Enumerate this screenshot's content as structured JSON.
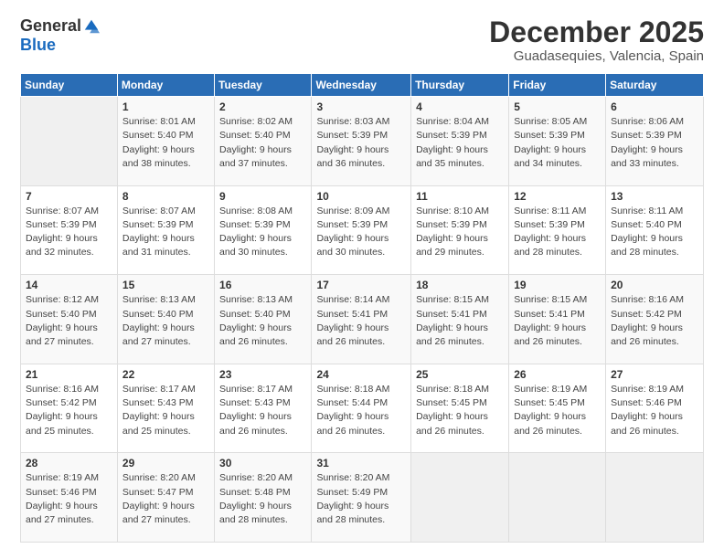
{
  "logo": {
    "general": "General",
    "blue": "Blue"
  },
  "title": "December 2025",
  "subtitle": "Guadasequies, Valencia, Spain",
  "header_days": [
    "Sunday",
    "Monday",
    "Tuesday",
    "Wednesday",
    "Thursday",
    "Friday",
    "Saturday"
  ],
  "weeks": [
    [
      {
        "day": "",
        "info": ""
      },
      {
        "day": "1",
        "info": "Sunrise: 8:01 AM\nSunset: 5:40 PM\nDaylight: 9 hours\nand 38 minutes."
      },
      {
        "day": "2",
        "info": "Sunrise: 8:02 AM\nSunset: 5:40 PM\nDaylight: 9 hours\nand 37 minutes."
      },
      {
        "day": "3",
        "info": "Sunrise: 8:03 AM\nSunset: 5:39 PM\nDaylight: 9 hours\nand 36 minutes."
      },
      {
        "day": "4",
        "info": "Sunrise: 8:04 AM\nSunset: 5:39 PM\nDaylight: 9 hours\nand 35 minutes."
      },
      {
        "day": "5",
        "info": "Sunrise: 8:05 AM\nSunset: 5:39 PM\nDaylight: 9 hours\nand 34 minutes."
      },
      {
        "day": "6",
        "info": "Sunrise: 8:06 AM\nSunset: 5:39 PM\nDaylight: 9 hours\nand 33 minutes."
      }
    ],
    [
      {
        "day": "7",
        "info": "Sunrise: 8:07 AM\nSunset: 5:39 PM\nDaylight: 9 hours\nand 32 minutes."
      },
      {
        "day": "8",
        "info": "Sunrise: 8:07 AM\nSunset: 5:39 PM\nDaylight: 9 hours\nand 31 minutes."
      },
      {
        "day": "9",
        "info": "Sunrise: 8:08 AM\nSunset: 5:39 PM\nDaylight: 9 hours\nand 30 minutes."
      },
      {
        "day": "10",
        "info": "Sunrise: 8:09 AM\nSunset: 5:39 PM\nDaylight: 9 hours\nand 30 minutes."
      },
      {
        "day": "11",
        "info": "Sunrise: 8:10 AM\nSunset: 5:39 PM\nDaylight: 9 hours\nand 29 minutes."
      },
      {
        "day": "12",
        "info": "Sunrise: 8:11 AM\nSunset: 5:39 PM\nDaylight: 9 hours\nand 28 minutes."
      },
      {
        "day": "13",
        "info": "Sunrise: 8:11 AM\nSunset: 5:40 PM\nDaylight: 9 hours\nand 28 minutes."
      }
    ],
    [
      {
        "day": "14",
        "info": "Sunrise: 8:12 AM\nSunset: 5:40 PM\nDaylight: 9 hours\nand 27 minutes."
      },
      {
        "day": "15",
        "info": "Sunrise: 8:13 AM\nSunset: 5:40 PM\nDaylight: 9 hours\nand 27 minutes."
      },
      {
        "day": "16",
        "info": "Sunrise: 8:13 AM\nSunset: 5:40 PM\nDaylight: 9 hours\nand 26 minutes."
      },
      {
        "day": "17",
        "info": "Sunrise: 8:14 AM\nSunset: 5:41 PM\nDaylight: 9 hours\nand 26 minutes."
      },
      {
        "day": "18",
        "info": "Sunrise: 8:15 AM\nSunset: 5:41 PM\nDaylight: 9 hours\nand 26 minutes."
      },
      {
        "day": "19",
        "info": "Sunrise: 8:15 AM\nSunset: 5:41 PM\nDaylight: 9 hours\nand 26 minutes."
      },
      {
        "day": "20",
        "info": "Sunrise: 8:16 AM\nSunset: 5:42 PM\nDaylight: 9 hours\nand 26 minutes."
      }
    ],
    [
      {
        "day": "21",
        "info": "Sunrise: 8:16 AM\nSunset: 5:42 PM\nDaylight: 9 hours\nand 25 minutes."
      },
      {
        "day": "22",
        "info": "Sunrise: 8:17 AM\nSunset: 5:43 PM\nDaylight: 9 hours\nand 25 minutes."
      },
      {
        "day": "23",
        "info": "Sunrise: 8:17 AM\nSunset: 5:43 PM\nDaylight: 9 hours\nand 26 minutes."
      },
      {
        "day": "24",
        "info": "Sunrise: 8:18 AM\nSunset: 5:44 PM\nDaylight: 9 hours\nand 26 minutes."
      },
      {
        "day": "25",
        "info": "Sunrise: 8:18 AM\nSunset: 5:45 PM\nDaylight: 9 hours\nand 26 minutes."
      },
      {
        "day": "26",
        "info": "Sunrise: 8:19 AM\nSunset: 5:45 PM\nDaylight: 9 hours\nand 26 minutes."
      },
      {
        "day": "27",
        "info": "Sunrise: 8:19 AM\nSunset: 5:46 PM\nDaylight: 9 hours\nand 26 minutes."
      }
    ],
    [
      {
        "day": "28",
        "info": "Sunrise: 8:19 AM\nSunset: 5:46 PM\nDaylight: 9 hours\nand 27 minutes."
      },
      {
        "day": "29",
        "info": "Sunrise: 8:20 AM\nSunset: 5:47 PM\nDaylight: 9 hours\nand 27 minutes."
      },
      {
        "day": "30",
        "info": "Sunrise: 8:20 AM\nSunset: 5:48 PM\nDaylight: 9 hours\nand 28 minutes."
      },
      {
        "day": "31",
        "info": "Sunrise: 8:20 AM\nSunset: 5:49 PM\nDaylight: 9 hours\nand 28 minutes."
      },
      {
        "day": "",
        "info": ""
      },
      {
        "day": "",
        "info": ""
      },
      {
        "day": "",
        "info": ""
      }
    ]
  ]
}
